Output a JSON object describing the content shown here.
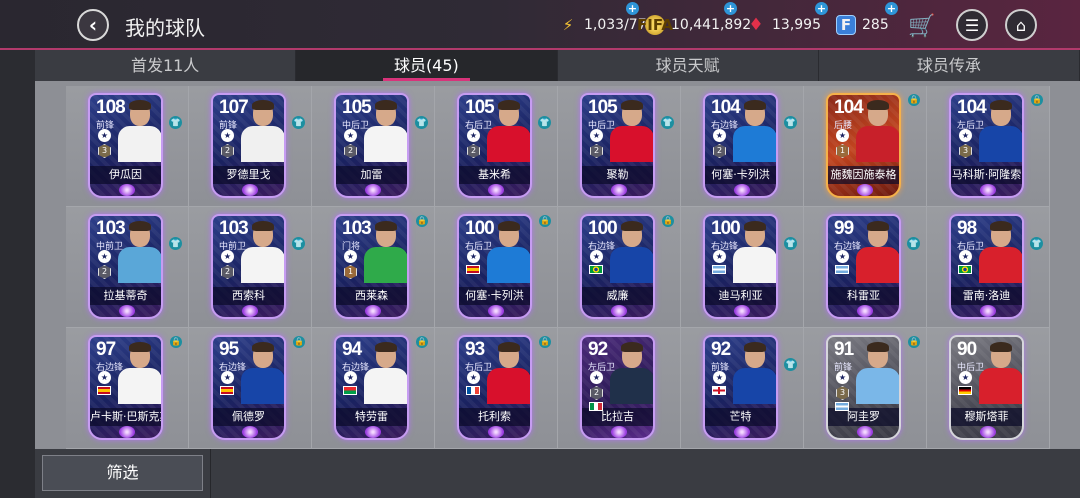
{
  "header": {
    "title": "我的球队",
    "stamina": "1,033/77",
    "coins": "10,441,892",
    "gems": "13,995",
    "points": "285",
    "points_icon_letter": "F"
  },
  "tabs": [
    {
      "label": "首发11人",
      "active": false
    },
    {
      "label": "球员(45)",
      "active": true
    },
    {
      "label": "球员天赋",
      "active": false
    },
    {
      "label": "球员传承",
      "active": false
    }
  ],
  "players": [
    {
      "ovr": "108",
      "pos": "前锋",
      "rank": "3",
      "name": "伊瓜因",
      "kit": "#f2f2f2",
      "style": "blue",
      "badge": "shirt"
    },
    {
      "ovr": "107",
      "pos": "前锋",
      "rank": "2",
      "name": "罗德里戈",
      "kit": "#f0f0f0",
      "style": "blue",
      "badge": "shirt"
    },
    {
      "ovr": "105",
      "pos": "中后卫",
      "rank": "2",
      "name": "加雷",
      "kit": "#f4f4f4",
      "style": "blue",
      "badge": "shirt"
    },
    {
      "ovr": "105",
      "pos": "右后卫",
      "rank": "2",
      "name": "基米希",
      "kit": "#d8102c",
      "style": "blue",
      "badge": "shirt"
    },
    {
      "ovr": "105",
      "pos": "中后卫",
      "rank": "2",
      "name": "聚勒",
      "kit": "#d8102c",
      "style": "blue",
      "badge": "shirt"
    },
    {
      "ovr": "104",
      "pos": "右边锋",
      "rank": "2",
      "name": "何塞·卡列洪",
      "kit": "#1e7bd6",
      "style": "blue",
      "badge": "shirt"
    },
    {
      "ovr": "104",
      "pos": "后腰",
      "rank": "1",
      "name": "施魏因施泰格",
      "kit": "#c8202a",
      "style": "gold",
      "badge": "lock"
    },
    {
      "ovr": "104",
      "pos": "左后卫",
      "rank": "3",
      "name": "马科斯·阿隆索",
      "kit": "#1745a8",
      "style": "blue",
      "badge": "lock"
    },
    {
      "ovr": "103",
      "pos": "中前卫",
      "rank": "2",
      "name": "拉基蒂奇",
      "kit": "#5aa7d8",
      "style": "blue",
      "badge": "shirt"
    },
    {
      "ovr": "103",
      "pos": "中前卫",
      "rank": "2",
      "name": "西索科",
      "kit": "#f4f4f4",
      "style": "blue",
      "badge": "shirt"
    },
    {
      "ovr": "103",
      "pos": "门将",
      "rank": "1",
      "name": "西莱森",
      "kit": "#2faa4a",
      "style": "blue",
      "badge": "lock"
    },
    {
      "ovr": "100",
      "pos": "右后卫",
      "rank": "",
      "name": "何塞·卡列洪",
      "kit": "#1e7bd6",
      "style": "blue",
      "badge": "lock",
      "flag": "es"
    },
    {
      "ovr": "100",
      "pos": "右边锋",
      "rank": "",
      "name": "威廉",
      "kit": "#1745a8",
      "style": "blue",
      "badge": "lock",
      "flag": "br"
    },
    {
      "ovr": "100",
      "pos": "右边锋",
      "rank": "",
      "name": "迪马利亚",
      "kit": "#f4f4f4",
      "style": "blue",
      "badge": "shirt",
      "flag": "ar"
    },
    {
      "ovr": "99",
      "pos": "右边锋",
      "rank": "",
      "name": "科雷亚",
      "kit": "#d8202c",
      "style": "blue",
      "badge": "shirt",
      "flag": "ar"
    },
    {
      "ovr": "98",
      "pos": "右后卫",
      "rank": "",
      "name": "雷南·洛迪",
      "kit": "#d8202c",
      "style": "blue",
      "badge": "shirt",
      "flag": "br"
    },
    {
      "ovr": "97",
      "pos": "右边锋",
      "rank": "",
      "name": "卢卡斯·巴斯克斯",
      "kit": "#f4f4f4",
      "style": "blue",
      "badge": "lock",
      "flag": "es"
    },
    {
      "ovr": "95",
      "pos": "右边锋",
      "rank": "",
      "name": "佩德罗",
      "kit": "#1745a8",
      "style": "blue",
      "badge": "lock",
      "flag": "es"
    },
    {
      "ovr": "94",
      "pos": "右边锋",
      "rank": "",
      "name": "特劳雷",
      "kit": "#f4f4f4",
      "style": "blue",
      "badge": "lock",
      "flag": "bf"
    },
    {
      "ovr": "93",
      "pos": "右后卫",
      "rank": "",
      "name": "托利索",
      "kit": "#d8102c",
      "style": "blue",
      "badge": "lock",
      "flag": "fr"
    },
    {
      "ovr": "92",
      "pos": "左后卫",
      "rank": "2",
      "name": "比拉吉",
      "kit": "#20304a",
      "style": "purple",
      "badge": "none",
      "flag": "it"
    },
    {
      "ovr": "92",
      "pos": "前锋",
      "rank": "",
      "name": "芒特",
      "kit": "#1745a8",
      "style": "blue",
      "badge": "shirt",
      "flag": "en"
    },
    {
      "ovr": "91",
      "pos": "前锋",
      "rank": "3",
      "name": "阿圭罗",
      "kit": "#7ab7e8",
      "style": "grayish",
      "badge": "lock",
      "flag": "ar"
    },
    {
      "ovr": "90",
      "pos": "中后卫",
      "rank": "",
      "name": "穆斯塔菲",
      "kit": "#d8202c",
      "style": "grayish",
      "badge": "none",
      "flag": "de"
    }
  ],
  "footer": {
    "filter_label": "筛选"
  }
}
